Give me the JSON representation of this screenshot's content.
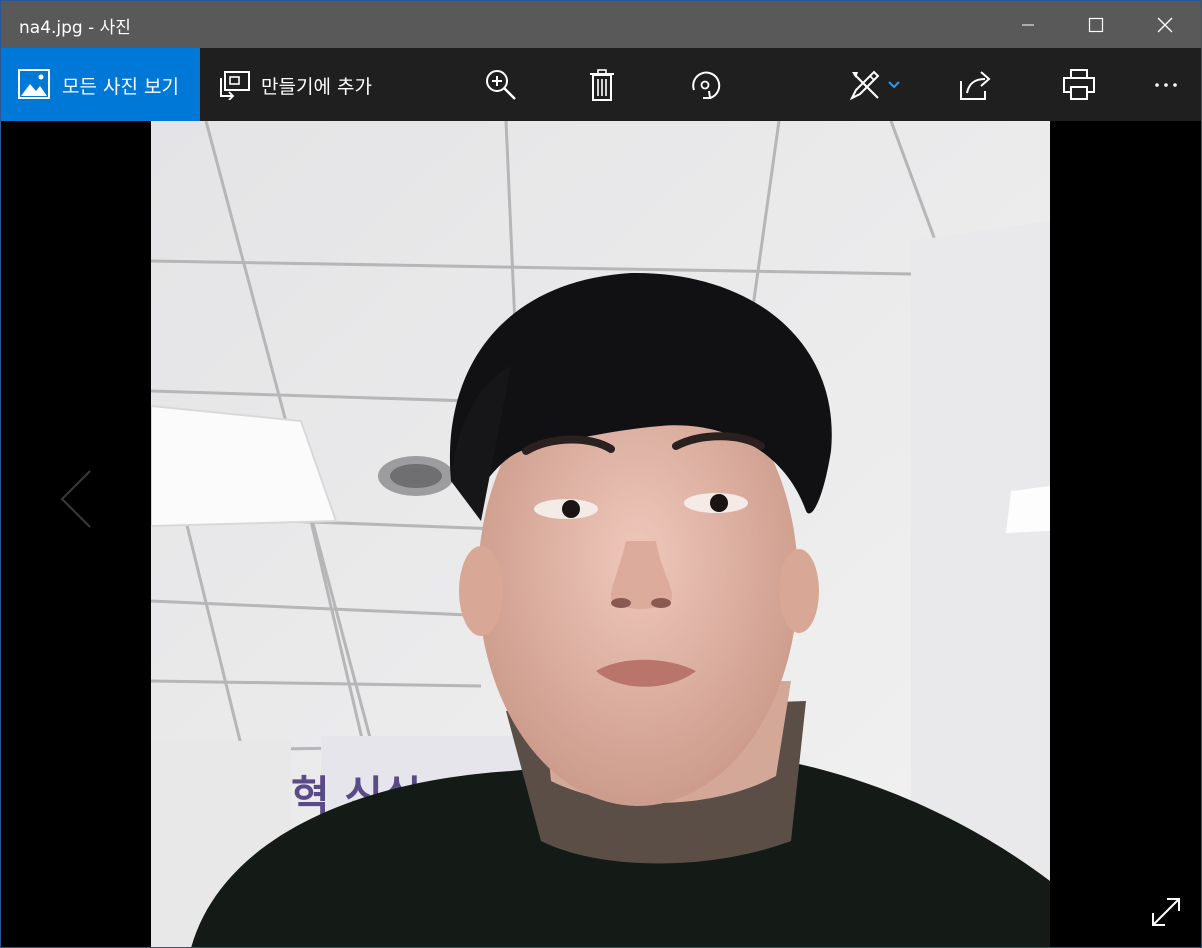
{
  "window": {
    "title": "na4.jpg - 사진",
    "accent": "#0078d7",
    "titlebar_color": "#595959",
    "toolbar_color": "#1f1f1f"
  },
  "toolbar": {
    "all_photos_label": "모든 사진 보기",
    "add_to_creation_label": "만들기에 추가",
    "icons": [
      "zoom-in-icon",
      "delete-icon",
      "rotate-icon",
      "edit-draw-icon",
      "share-icon",
      "print-icon",
      "more-icon"
    ]
  },
  "viewer": {
    "image_name": "na4.jpg",
    "image_background": "#000000"
  }
}
